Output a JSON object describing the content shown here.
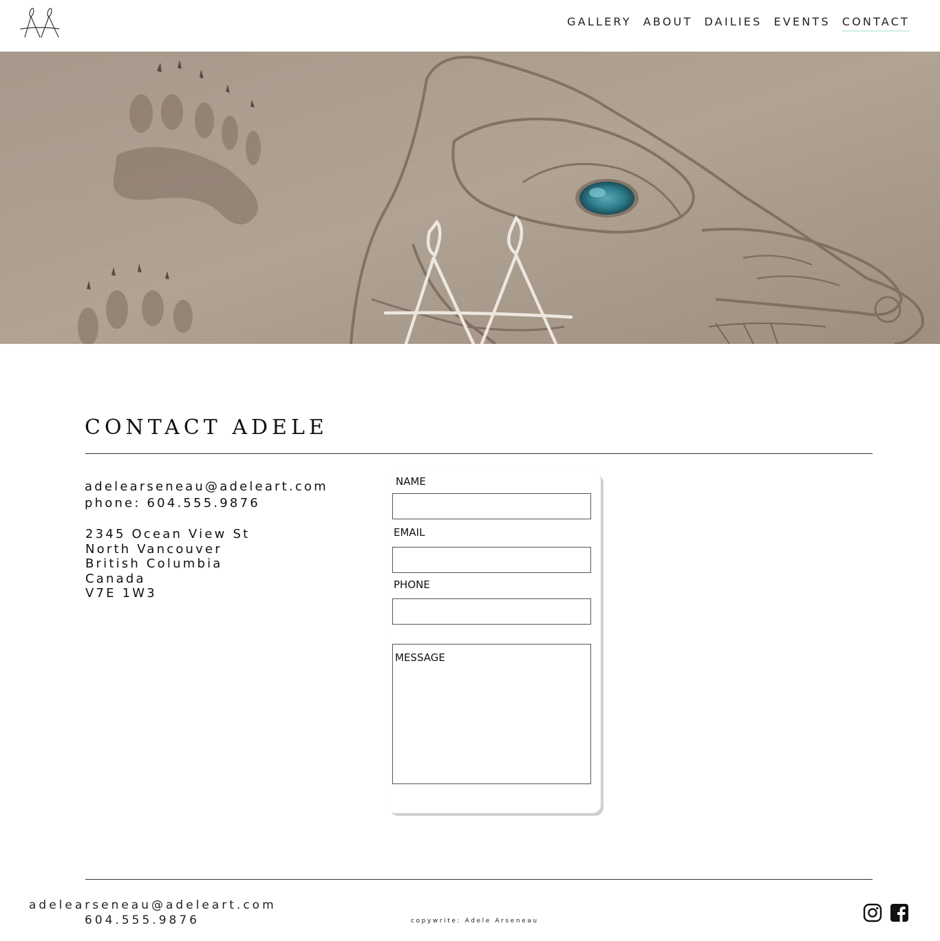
{
  "header": {
    "logo_icon": "aa-monogram-logo-icon",
    "nav": [
      {
        "label": "GALLERY",
        "active": false
      },
      {
        "label": "ABOUT",
        "active": false
      },
      {
        "label": "DAILIES",
        "active": false
      },
      {
        "label": "EVENTS",
        "active": false
      },
      {
        "label": "CONTACT",
        "active": true
      }
    ],
    "active_underline_color": "#cfeee2"
  },
  "hero": {
    "image": "carved-wood-bear-panel-with-abalone-eye",
    "overlay_logo_icon": "aa-monogram-logo-icon"
  },
  "main": {
    "title": "CONTACT ADELE",
    "email": "adelearseneau@adeleart.com",
    "phone": "phone: 604.555.9876",
    "address": [
      "2345 Ocean View St",
      "North Vancouver",
      "British Columbia",
      "Canada",
      "V7E 1W3"
    ]
  },
  "form": {
    "name_label": "NAME",
    "name_value": "",
    "email_label": "EMAIL",
    "email_value": "",
    "phone_label": "PHONE",
    "phone_value": "",
    "message_placeholder": "MESSAGE",
    "message_value": ""
  },
  "footer": {
    "email": "adelearseneau@adeleart.com",
    "phone": "604.555.9876",
    "copyright": "copywrite: Adele Arseneau",
    "social": [
      "instagram-icon",
      "facebook-icon"
    ]
  }
}
